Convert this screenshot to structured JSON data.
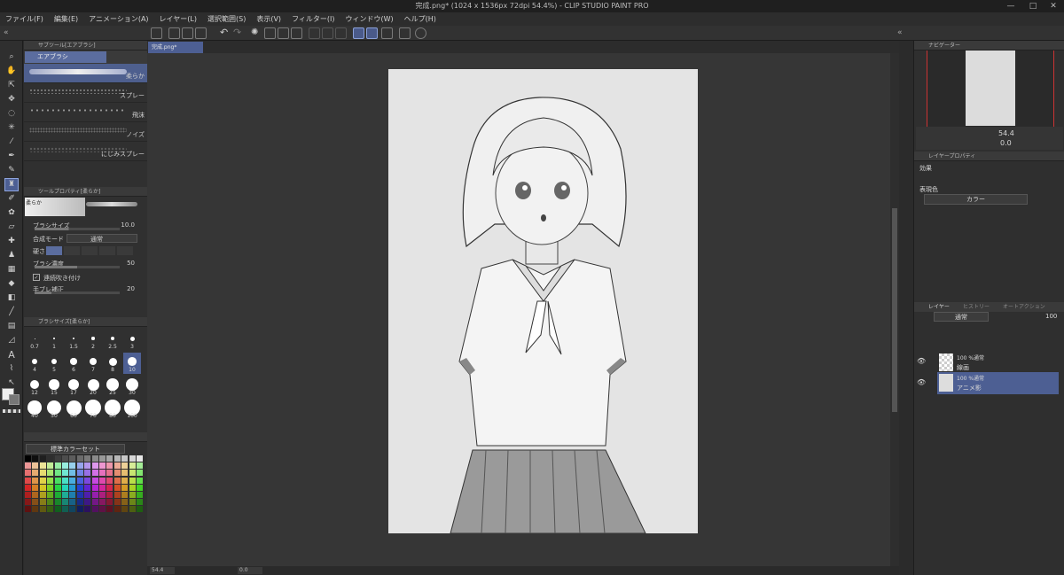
{
  "window": {
    "title": "完成.png* (1024 x 1536px 72dpi 54.4%) - CLIP STUDIO PAINT PRO",
    "min": "—",
    "max": "□",
    "close": "✕"
  },
  "menu": [
    "ファイル(F)",
    "編集(E)",
    "アニメーション(A)",
    "レイヤー(L)",
    "選択範囲(S)",
    "表示(V)",
    "フィルター(I)",
    "ウィンドウ(W)",
    "ヘルプ(H)"
  ],
  "subtool": {
    "header": "サブツール[エアブラシ]",
    "group": "エアブラシ",
    "items": [
      "柔らか",
      "スプレー",
      "飛沫",
      "ノイズ",
      "にじみスプレー"
    ]
  },
  "toolprop": {
    "header": "ツールプロパティ[柔らか]",
    "preview_label": "柔らか",
    "brush_size_label": "ブラシサイズ",
    "brush_size": "10.0",
    "blend_label": "合成モード",
    "blend_value": "通常",
    "hardness_label": "硬さ",
    "density_label": "ブラシ濃度",
    "density": "50",
    "continuous_label": "連続吹き付け",
    "stabilize_label": "手ブレ補正",
    "stabilize": "20"
  },
  "brushsize": {
    "header": "ブラシサイズ[柔らか]",
    "sizes": [
      "0.7",
      "1",
      "1.5",
      "2",
      "2.5",
      "3",
      "4",
      "5",
      "6",
      "7",
      "8",
      "10",
      "12",
      "15",
      "17",
      "20",
      "25",
      "30",
      "40",
      "50",
      "60",
      "70",
      "80",
      "100"
    ]
  },
  "colorset": {
    "name": "標準カラーセット"
  },
  "canvas": {
    "tab": "完成.png*"
  },
  "status": {
    "zoom": "54.4",
    "angle": "0.0"
  },
  "navigator": {
    "header": "ナビゲーター",
    "zoom": "54.4",
    "angle": "0.0"
  },
  "layerprop": {
    "header": "レイヤープロパティ",
    "effect_label": "効果",
    "color_label": "表現色",
    "color_value": "カラー"
  },
  "layers": {
    "tabs": [
      "レイヤー",
      "ヒストリー",
      "オートアクション"
    ],
    "blend": "通常",
    "opacity": "100",
    "items": [
      {
        "top": "100 %通常",
        "name": "線画"
      },
      {
        "top": "100 %通常",
        "name": "アニメ影"
      }
    ]
  },
  "colors": {
    "accent": "#4d5f93",
    "panel": "#303030",
    "bg": "#2b2b2b"
  }
}
